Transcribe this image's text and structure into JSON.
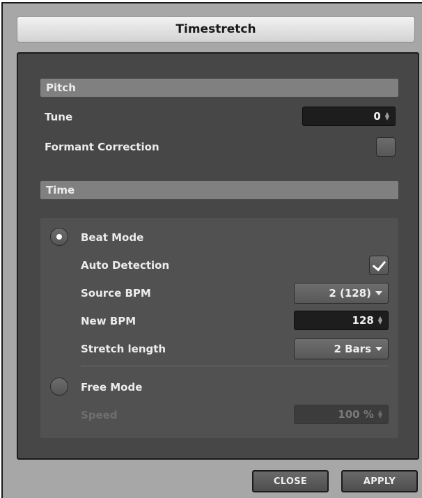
{
  "dialog": {
    "title": "Timestretch"
  },
  "pitch": {
    "header": "Pitch",
    "tune_label": "Tune",
    "tune_value": "0",
    "formant_label": "Formant Correction",
    "formant_checked": false
  },
  "time": {
    "header": "Time",
    "beat_mode": {
      "label": "Beat Mode",
      "selected": true,
      "auto_detection_label": "Auto Detection",
      "auto_detection_checked": true,
      "source_bpm_label": "Source BPM",
      "source_bpm_value": "2 (128)",
      "new_bpm_label": "New BPM",
      "new_bpm_value": "128",
      "stretch_length_label": "Stretch length",
      "stretch_length_value": "2 Bars"
    },
    "free_mode": {
      "label": "Free Mode",
      "selected": false,
      "speed_label": "Speed",
      "speed_value": "100 %"
    }
  },
  "footer": {
    "close_label": "CLOSE",
    "apply_label": "APPLY"
  },
  "icons": {
    "spinner": "up-down-arrows-icon",
    "dropdown": "chevron-down-icon",
    "check": "checkmark-icon",
    "radio": "radio-dot-icon"
  },
  "colors": {
    "window_bg": "#a7a7a7",
    "panel_bg": "#474747",
    "section_header_bg": "#808080",
    "field_bg": "#1d1d1d",
    "text": "#ececec",
    "disabled_text": "#6f6f6f"
  }
}
